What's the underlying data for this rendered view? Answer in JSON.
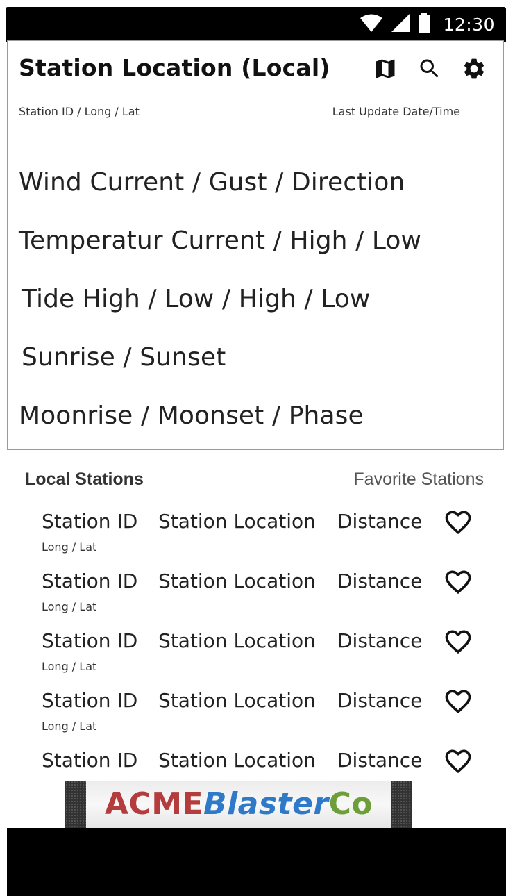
{
  "status_bar": {
    "time": "12:30",
    "icons": [
      "wifi-icon",
      "signal-icon",
      "battery-icon"
    ]
  },
  "header": {
    "title": "Station Location (Local)",
    "actions": [
      "map-icon",
      "search-icon",
      "gear-icon"
    ],
    "station_meta": "Station ID / Long / Lat",
    "last_update": "Last Update Date/Time"
  },
  "readings": {
    "wind": "Wind  Current / Gust / Direction",
    "temperature": "Temperatur Current / High / Low",
    "tide": "Tide High / Low / High / Low",
    "sun": "Sunrise / Sunset",
    "moon": "Moonrise / Moonset / Phase"
  },
  "tabs": {
    "local": "Local Stations",
    "favorite": "Favorite Stations"
  },
  "stations": [
    {
      "id": "Station ID",
      "location": "Station Location",
      "distance": "Distance",
      "coords": "Long / Lat"
    },
    {
      "id": "Station ID",
      "location": "Station Location",
      "distance": "Distance",
      "coords": "Long / Lat"
    },
    {
      "id": "Station ID",
      "location": "Station Location",
      "distance": "Distance",
      "coords": "Long / Lat"
    },
    {
      "id": "Station ID",
      "location": "Station Location",
      "distance": "Distance",
      "coords": "Long / Lat"
    },
    {
      "id": "Station ID",
      "location": "Station Location",
      "distance": "Distance",
      "coords": ""
    }
  ],
  "ad": {
    "part1": "ACME",
    "part2": "Blaster",
    "part3": "Co",
    "colors": {
      "acme": "#b43c3c",
      "blaster": "#2e79c8",
      "co": "#6e9e3a"
    }
  },
  "colors": {
    "status_bar": "#000000",
    "nav_bar": "#000000",
    "card_border": "#9a9a9a"
  }
}
